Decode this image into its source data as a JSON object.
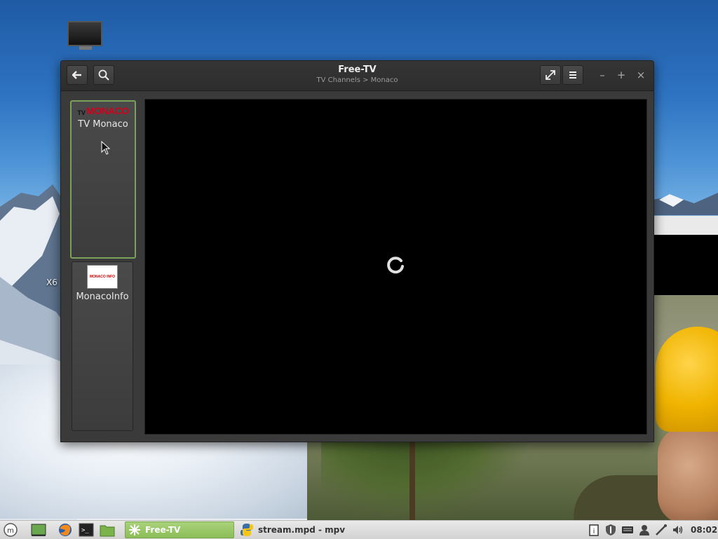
{
  "window": {
    "title": "Free-TV",
    "subtitle": "TV Channels > Monaco"
  },
  "channels": [
    {
      "name": "TV Monaco",
      "logo_text_prefix": "TV",
      "logo_text": "MONACO",
      "selected": true
    },
    {
      "name": "MonacoInfo",
      "logo_text": "MONACO INFO",
      "selected": false
    }
  ],
  "desktop": {
    "partial_label": "X6"
  },
  "taskbar": {
    "tasks": [
      {
        "label": "Free-TV",
        "active": true
      },
      {
        "label": "stream.mpd - mpv",
        "active": false
      }
    ],
    "clock": "08:02"
  },
  "colors": {
    "selected_border": "#7aa05a",
    "active_task": "#8cbe58",
    "logo_red": "#d0021b"
  },
  "icons": [
    "back-arrow-icon",
    "search-icon",
    "fullscreen-icon",
    "menu-icon",
    "minimize-icon",
    "maximize-icon",
    "close-icon",
    "loading-spinner-icon",
    "mint-menu-icon",
    "show-desktop-icon",
    "firefox-icon",
    "terminal-icon",
    "files-icon",
    "python-icon",
    "update-manager-icon",
    "shield-icon",
    "keyboard-icon",
    "user-icon",
    "network-icon",
    "volume-icon"
  ]
}
